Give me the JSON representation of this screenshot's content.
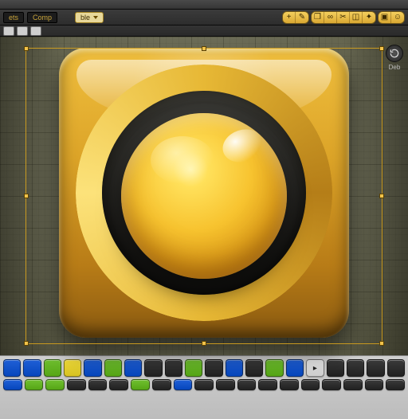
{
  "top": {
    "menu_hint": "ets",
    "crumb": "Comp",
    "dropdown": "ble",
    "tool_icons": [
      "plus",
      "pencil",
      "copy",
      "link",
      "cut",
      "crop",
      "wand",
      "group",
      "user"
    ],
    "refresh_label": "Deb"
  },
  "secondary": {
    "mini_count": 3
  },
  "canvas": {
    "has_selection": true,
    "object_name": "golden-round-button"
  },
  "swatches": {
    "row1": [
      "#1f5fd6",
      "#1f5fd6",
      "#6fbf2f",
      "#f1dc3a",
      "#1f5fd6",
      "#6fbf2f",
      "#1f5fd6",
      "#3a3a3a",
      "#3a3a3a",
      "#6fbf2f",
      "#3a3a3a",
      "#1f5fd6",
      "#3a3a3a",
      "#6fbf2f",
      "#1f5fd6",
      "#e8e8e8",
      "#3a3a3a",
      "#3a3a3a",
      "#3a3a3a",
      "#3a3a3a"
    ],
    "row1_actions": [
      15
    ],
    "row2": [
      "#1f5fd6",
      "#6fbf2f",
      "#6fbf2f",
      "#3a3a3a",
      "#3a3a3a",
      "#3a3a3a",
      "#6fbf2f",
      "#3a3a3a",
      "#1f5fd6",
      "#3a3a3a",
      "#383838",
      "#3a3a3a",
      "#3a3a3a",
      "#3a3a3a",
      "#3a3a3a",
      "#3a3a3a",
      "#3a3a3a",
      "#3a3a3a",
      "#3a3a3a"
    ]
  }
}
